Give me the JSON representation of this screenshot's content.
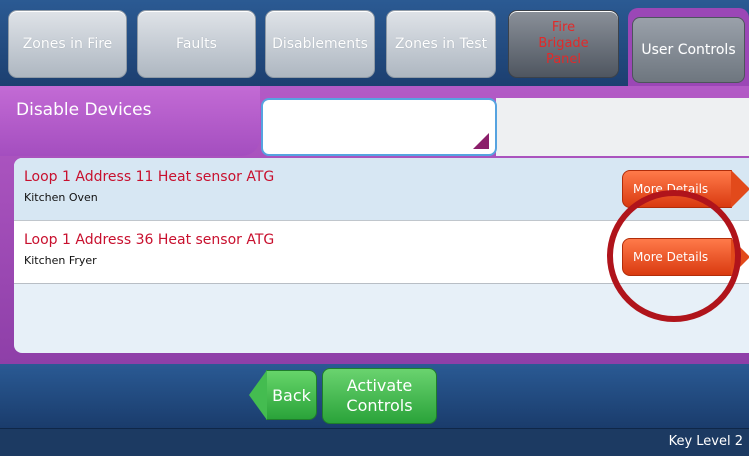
{
  "tabs": [
    {
      "label": "Zones in Fire"
    },
    {
      "label": "Faults"
    },
    {
      "label": "Disablements"
    },
    {
      "label": "Zones in Test"
    },
    {
      "label": "Fire Brigade Panel"
    },
    {
      "label": "User Controls"
    }
  ],
  "panel": {
    "title": "Disable Devices",
    "search": {
      "value": "",
      "placeholder": ""
    }
  },
  "devices": [
    {
      "title": "Loop 1 Address 11 Heat sensor ATG",
      "subtitle": "Kitchen Oven",
      "button": "More Details"
    },
    {
      "title": "Loop 1 Address 36 Heat sensor ATG",
      "subtitle": "Kitchen Fryer",
      "button": "More Details"
    }
  ],
  "footer": {
    "back_label": "Back",
    "activate_label": "Activate Controls"
  },
  "status": {
    "key_level": "Key Level 2"
  },
  "colors": {
    "accent_purple": "#9b47b6",
    "alarm_red": "#c8102e",
    "button_orange": "#e24a1b",
    "button_green": "#2aa33a",
    "highlight_ring": "#b0141b"
  }
}
